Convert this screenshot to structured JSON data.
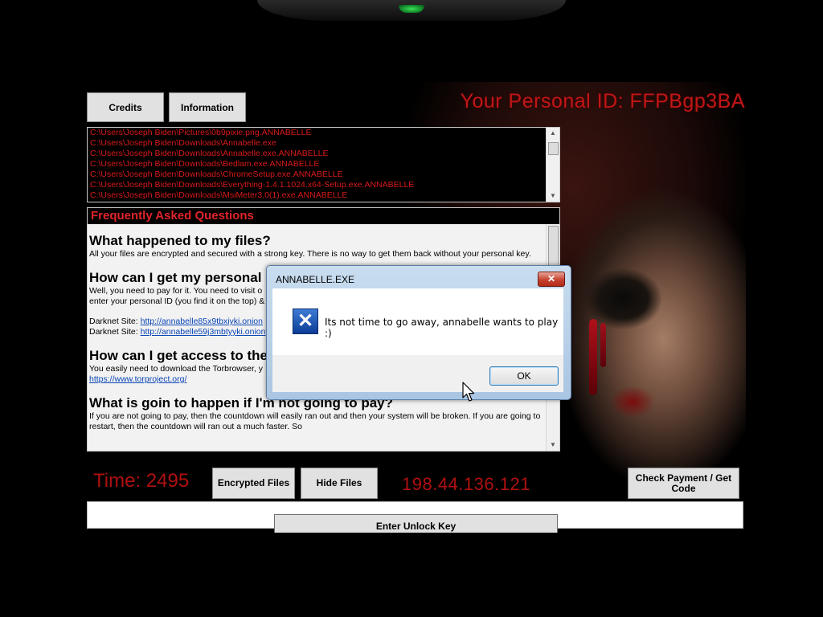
{
  "window": {
    "personal_id": "Your Personal ID: FFPBgp3BA",
    "buttons": {
      "credits": "Credits",
      "information": "Information",
      "encrypted_files": "Encrypted Files",
      "hide_files": "Hide Files",
      "check_payment": "Check Payment / Get Code",
      "enter_unlock_key": "Enter Unlock Key"
    },
    "timer": "Time: 2495",
    "ip": "198.44.136.121",
    "unlock_key_value": ""
  },
  "file_log": [
    "C:\\Users\\Joseph Biden\\Pictures\\0b9pixie.png.ANNABELLE",
    "C:\\Users\\Joseph Biden\\Downloads\\Annabelle.exe",
    "C:\\Users\\Joseph Biden\\Downloads\\Annabelle.exe.ANNABELLE",
    "C:\\Users\\Joseph Biden\\Downloads\\Bedlam.exe.ANNABELLE",
    "C:\\Users\\Joseph Biden\\Downloads\\ChromeSetup.exe.ANNABELLE",
    "C:\\Users\\Joseph Biden\\Downloads\\Everything-1.4.1.1024.x64-Setup.exe.ANNABELLE",
    "C:\\Users\\Joseph Biden\\Downloads\\MsiMeter3.0(1).exe.ANNABELLE"
  ],
  "faq": {
    "title": "Frequently Asked Questions",
    "q1": {
      "heading": "What happened to my files?",
      "text": "All your files are encrypted and secured with a strong key. There is no way to get them back without your personal key."
    },
    "q2": {
      "heading": "How can I get my personal",
      "text1": "Well, you need to pay for it. You need to visit o",
      "text2": "enter your personal ID (you find it on the top) &",
      "darknet_label1": "Darknet Site:",
      "darknet_link1": "http://annabelle85x9tbxiyki.onion",
      "darknet_label2": "Darknet Site:",
      "darknet_link2": "http://annabelle59j3mbtyyki.onion"
    },
    "q3": {
      "heading": "How can I get access to the",
      "text": "You easily need to download the Torbrowser, y",
      "link": "https://www.torproject.org/"
    },
    "q4": {
      "heading": "What is goin to happen if I'm not going to pay?",
      "text": "If you are not going to pay, then the countdown will easily ran out and then your system will be broken. If you are going to restart, then the countdown will ran out a much faster. So"
    }
  },
  "dialog": {
    "title": "ANNABELLE.EXE",
    "close": "✕",
    "message": "Its not time to go away, annabelle wants to play :)",
    "icon": "error-x-icon",
    "ok": "OK"
  }
}
